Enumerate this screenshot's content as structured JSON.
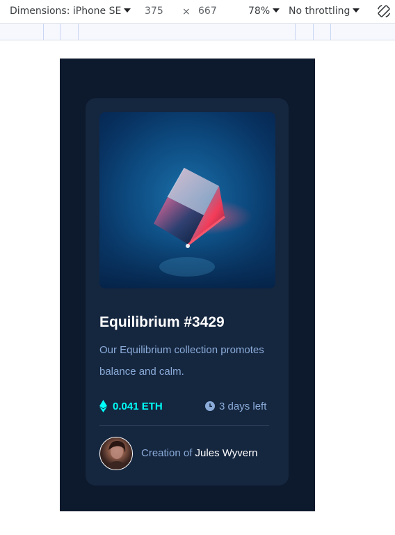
{
  "devtools": {
    "dimensions_label": "Dimensions: iPhone SE",
    "width": "375",
    "times": "×",
    "height": "667",
    "zoom": "78%",
    "throttling": "No throttling"
  },
  "card": {
    "title": "Equilibrium #3429",
    "description": "Our Equilibrium collection promotes balance and calm.",
    "price": "0.041 ETH",
    "time_left": "3 days left",
    "creator_prefix": "Creation of",
    "creator_name": "Jules Wyvern",
    "hero_icon": "crystal-cube-image",
    "price_icon": "ethereum-icon",
    "time_icon": "clock-icon"
  },
  "colors": {
    "page_bg": "#0d192c",
    "card_bg": "#15263f",
    "accent_cyan": "#00fff8",
    "soft_blue": "#8bacd9",
    "white": "#ffffff"
  }
}
